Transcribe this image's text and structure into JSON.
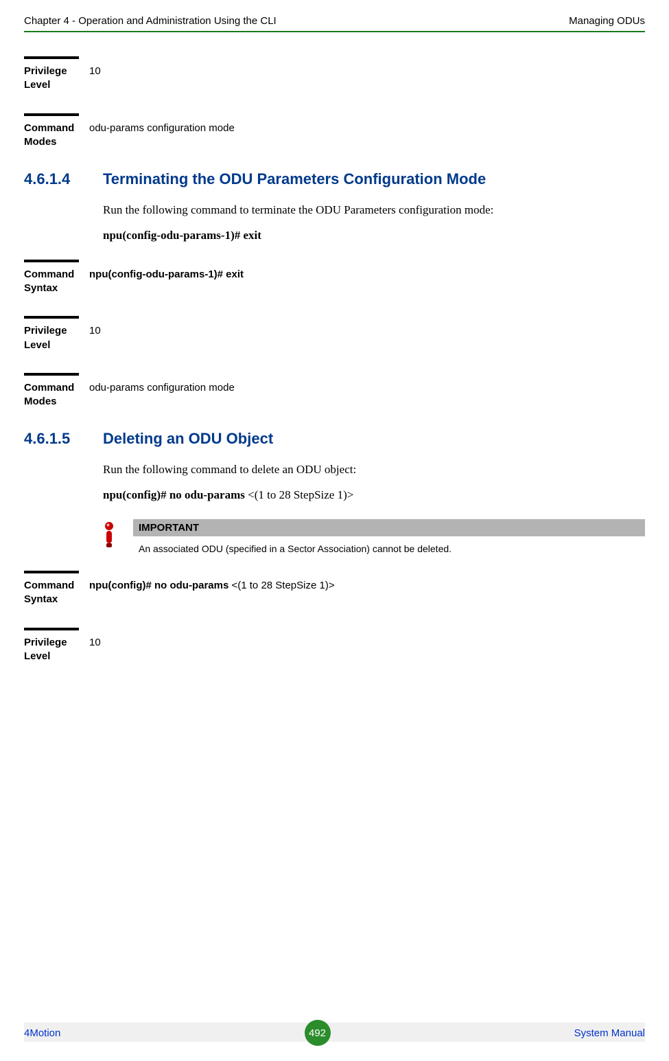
{
  "header": {
    "left": "Chapter 4 - Operation and Administration Using the CLI",
    "right": "Managing ODUs"
  },
  "defs": {
    "priv_label": "Privilege Level",
    "priv_value": "10",
    "modes_label": "Command Modes",
    "modes_value": "odu-params configuration mode",
    "syntax_label": "Command Syntax",
    "syntax_value_exit": "npu(config-odu-params-1)# exit",
    "syntax_value_no": "npu(config)# no odu-params <(1 to 28 StepSize 1)>"
  },
  "sections": {
    "s1": {
      "number": "4.6.1.4",
      "title": "Terminating the ODU Parameters Configuration Mode",
      "body": "Run the following command to terminate the ODU Parameters configuration mode:",
      "cmd": "npu(config-odu-params-1)# exit"
    },
    "s2": {
      "number": "4.6.1.5",
      "title": "Deleting an ODU Object",
      "body": "Run the following command to delete an ODU object:",
      "cmd_bold": "npu(config)# no odu-params ",
      "cmd_rest": "<(1 to 28 StepSize 1)>"
    }
  },
  "important": {
    "header": "IMPORTANT",
    "text": "An associated ODU (specified in a Sector Association) cannot be deleted."
  },
  "footer": {
    "left": "4Motion",
    "center": "492",
    "right": "System Manual"
  }
}
